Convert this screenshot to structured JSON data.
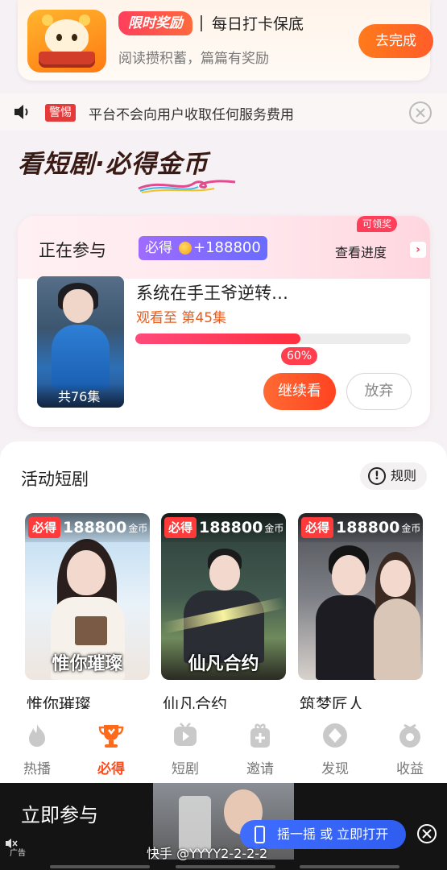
{
  "reward_banner": {
    "badge": "限时奖励",
    "title": "每日打卡保底",
    "subtitle": "阅读攒积蓄，篇篇有奖励",
    "button": "去完成"
  },
  "notice": {
    "tag": "警惕",
    "text": "平台不会向用户收取任何服务费用"
  },
  "heading": "看短剧·必得金币",
  "participating": {
    "label": "正在参与",
    "bonus_prefix": "必得",
    "bonus_amount": "+188800",
    "claim_tag": "可领奖",
    "view_progress": "查看进度",
    "drama_title": "系统在手王爷逆转…",
    "watched": "观看至 第45集",
    "episodes": "共76集",
    "progress_percent": 60,
    "progress_label": "60%",
    "continue_button": "继续看",
    "give_up_button": "放弃"
  },
  "activity": {
    "title": "活动短剧",
    "rules_button": "规则",
    "cards": [
      {
        "must": "必得",
        "amount": "188800",
        "unit": "金币",
        "caption": "惟你璀璨",
        "name": "惟你璀璨"
      },
      {
        "must": "必得",
        "amount": "188800",
        "unit": "金币",
        "caption": "仙凡合约",
        "name": "仙凡合约"
      },
      {
        "must": "必得",
        "amount": "188800",
        "unit": "金币",
        "caption": "",
        "name": "筑梦匠人"
      }
    ]
  },
  "nav": [
    {
      "label": "热播",
      "icon": "flame-icon",
      "active": false
    },
    {
      "label": "必得",
      "icon": "trophy-icon",
      "active": true
    },
    {
      "label": "短剧",
      "icon": "play-icon",
      "active": false
    },
    {
      "label": "邀请",
      "icon": "gift-add-icon",
      "active": false
    },
    {
      "label": "发现",
      "icon": "compass-icon",
      "active": false
    },
    {
      "label": "收益",
      "icon": "wallet-icon",
      "active": false
    }
  ],
  "ad": {
    "join_text": "立即参与",
    "shake_text": "摇一摇 或 立即打开",
    "ad_label": "广告",
    "watermark": "快手 @YYYY2-2-2-2"
  },
  "colors": {
    "accent": "#ff5d2a",
    "progress": "#ff2f3e",
    "shake_button": "#3f6dff"
  }
}
